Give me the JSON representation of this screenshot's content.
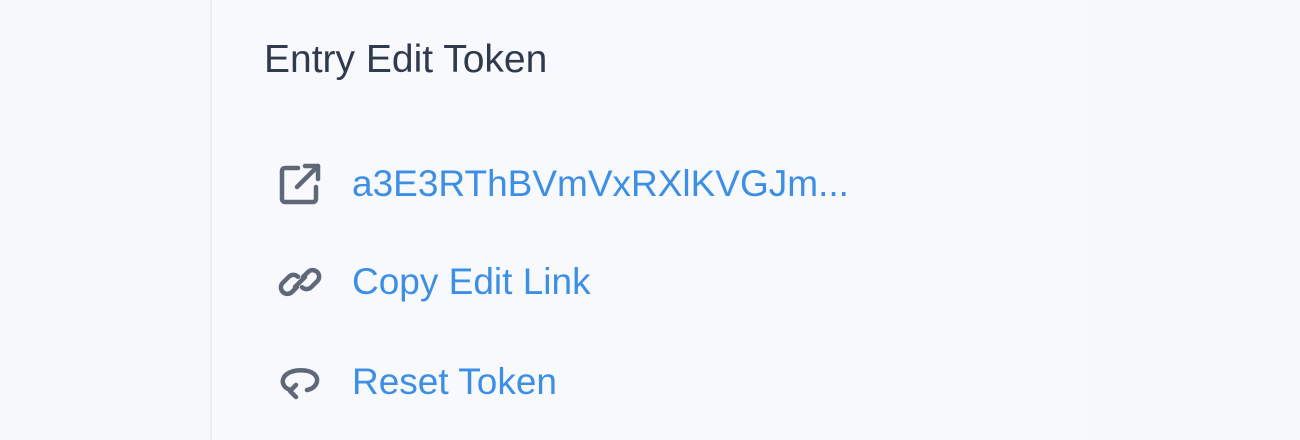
{
  "panel": {
    "title": "Entry Edit Token"
  },
  "actions": [
    {
      "id": "open-token",
      "label": "a3E3RThBVmVxRXlKVGJm...",
      "icon": "external-link-icon"
    },
    {
      "id": "copy-link",
      "label": "Copy Edit Link",
      "icon": "link-icon"
    },
    {
      "id": "reset-token",
      "label": "Reset Token",
      "icon": "reset-arrow-icon"
    }
  ],
  "colors": {
    "title": "#2f3a4d",
    "link": "#3d8fe6",
    "icon": "#5f6878",
    "background": "#f7f8fa"
  }
}
